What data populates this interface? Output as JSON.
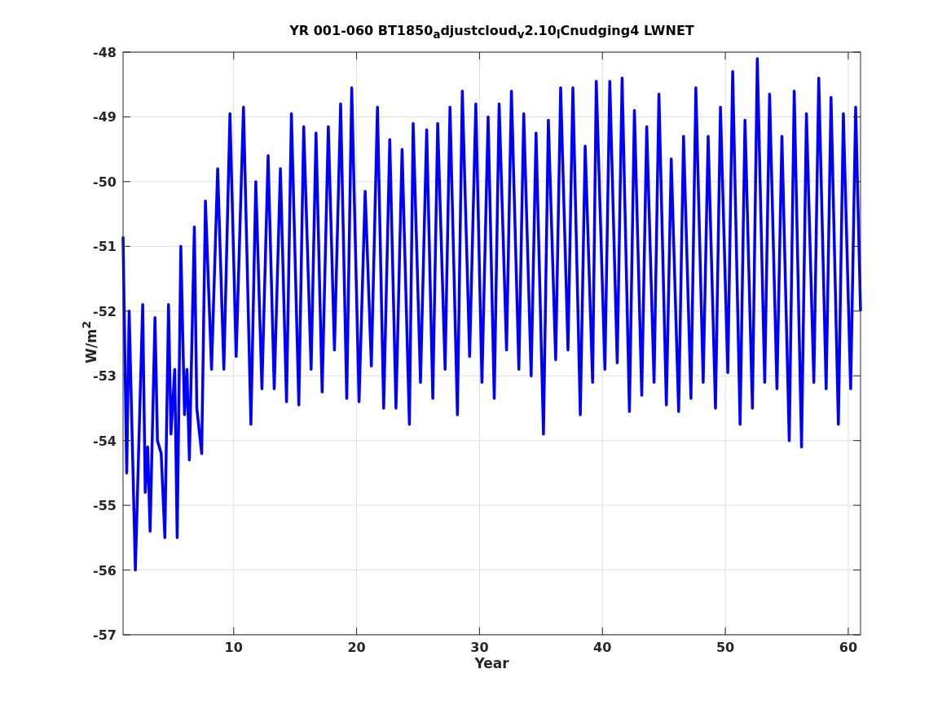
{
  "figure": {
    "chart_data": {
      "type": "line",
      "title": "YR 001-060 BT1850$_{a}$djustcloud$_{v}$2.10$_{l}$Cnudging4 LWNET",
      "xlabel": "Year",
      "ylabel": "W/m$^{2}$",
      "xlim": [
        1,
        61
      ],
      "ylim": [
        -57,
        -48
      ],
      "xticks": [
        10,
        20,
        30,
        40,
        50,
        60
      ],
      "yticks": [
        -57,
        -56,
        -55,
        -54,
        -53,
        -52,
        -51,
        -50,
        -49,
        -48
      ],
      "x": [
        1.0,
        1.3,
        1.5,
        2.0,
        2.6,
        2.8,
        3.0,
        3.2,
        3.6,
        3.8,
        4.1,
        4.4,
        4.7,
        4.9,
        5.2,
        5.4,
        5.7,
        6.0,
        6.2,
        6.4,
        6.8,
        7.0,
        7.4,
        7.7,
        8.2,
        8.7,
        9.2,
        9.7,
        10.2,
        10.8,
        11.4,
        11.8,
        12.3,
        12.8,
        13.3,
        13.8,
        14.3,
        14.7,
        15.3,
        15.7,
        16.3,
        16.7,
        17.2,
        17.7,
        18.2,
        18.7,
        19.2,
        19.6,
        20.2,
        20.7,
        21.2,
        21.7,
        22.2,
        22.7,
        23.2,
        23.7,
        24.3,
        24.6,
        25.2,
        25.7,
        26.2,
        26.6,
        27.2,
        27.6,
        28.2,
        28.6,
        29.2,
        29.7,
        30.2,
        30.7,
        31.2,
        31.6,
        32.2,
        32.6,
        33.2,
        33.6,
        34.2,
        34.6,
        35.2,
        35.6,
        36.2,
        36.6,
        37.2,
        37.6,
        38.2,
        38.6,
        39.2,
        39.5,
        40.2,
        40.6,
        41.2,
        41.6,
        42.2,
        42.6,
        43.2,
        43.6,
        44.2,
        44.6,
        45.2,
        45.6,
        46.2,
        46.6,
        47.2,
        47.6,
        48.2,
        48.6,
        49.2,
        49.6,
        50.2,
        50.6,
        51.2,
        51.6,
        52.2,
        52.6,
        53.2,
        53.6,
        54.2,
        54.6,
        55.2,
        55.6,
        56.2,
        56.6,
        57.2,
        57.6,
        58.2,
        58.6,
        59.2,
        59.6,
        60.2,
        60.6,
        61.0
      ],
      "grid": true,
      "series": [
        {
          "color": "#0000ff",
          "values": [
            -50.85,
            -54.5,
            -52.0,
            -56.0,
            -51.9,
            -54.8,
            -54.1,
            -55.4,
            -52.1,
            -54.0,
            -54.2,
            -55.5,
            -51.9,
            -53.9,
            -52.9,
            -55.5,
            -51.0,
            -53.6,
            -52.9,
            -54.3,
            -50.7,
            -53.5,
            -54.2,
            -50.3,
            -52.9,
            -49.8,
            -52.9,
            -48.95,
            -52.7,
            -48.85,
            -53.75,
            -50.0,
            -53.2,
            -49.6,
            -53.2,
            -49.8,
            -53.4,
            -48.95,
            -53.45,
            -49.15,
            -52.9,
            -49.25,
            -53.25,
            -49.15,
            -52.6,
            -48.8,
            -53.35,
            -48.55,
            -53.4,
            -50.15,
            -52.85,
            -48.85,
            -53.5,
            -49.35,
            -53.5,
            -49.5,
            -53.75,
            -49.1,
            -53.1,
            -49.2,
            -53.35,
            -49.1,
            -52.9,
            -48.85,
            -53.6,
            -48.6,
            -52.7,
            -48.8,
            -53.1,
            -49.0,
            -53.35,
            -48.8,
            -52.6,
            -48.6,
            -52.9,
            -48.95,
            -53.0,
            -49.25,
            -53.9,
            -49.05,
            -52.75,
            -48.55,
            -52.6,
            -48.55,
            -53.6,
            -49.45,
            -53.1,
            -48.45,
            -52.9,
            -48.45,
            -52.8,
            -48.4,
            -53.55,
            -48.9,
            -53.3,
            -49.15,
            -53.1,
            -48.65,
            -53.45,
            -49.65,
            -53.55,
            -49.3,
            -53.35,
            -48.55,
            -53.1,
            -49.3,
            -53.5,
            -48.85,
            -52.95,
            -48.3,
            -53.75,
            -49.05,
            -53.5,
            -48.1,
            -53.1,
            -48.65,
            -53.2,
            -49.3,
            -54.0,
            -48.6,
            -54.1,
            -48.95,
            -53.1,
            -48.4,
            -53.2,
            -48.7,
            -53.75,
            -48.95,
            -53.2,
            -48.85,
            -52.0
          ]
        }
      ]
    }
  }
}
